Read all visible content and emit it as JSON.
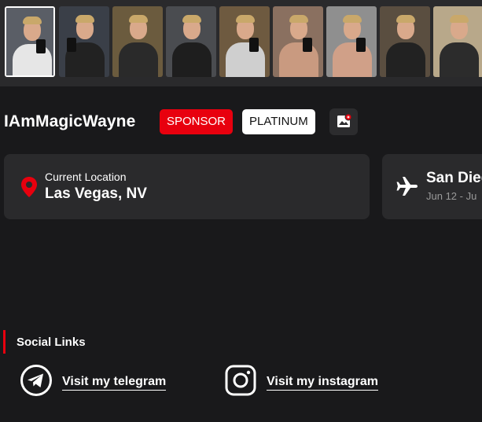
{
  "profile": {
    "name": "IAmMagicWayne",
    "badges": {
      "sponsor": "SPONSOR",
      "platinum": "PLATINUM"
    }
  },
  "photos": [
    {
      "name": "photo-1",
      "bg": "#5a5e66",
      "shirt": "#e6e6e6"
    },
    {
      "name": "photo-2",
      "bg": "#3a3f48",
      "shirt": "#222"
    },
    {
      "name": "photo-3",
      "bg": "#6b5b3e",
      "shirt": "#2a2a2a"
    },
    {
      "name": "photo-4",
      "bg": "#4a4c50",
      "shirt": "#1e1e1e"
    },
    {
      "name": "photo-5",
      "bg": "#6e5a40",
      "shirt": "#cfcfcf"
    },
    {
      "name": "photo-6",
      "bg": "#8a7060",
      "shirt": "#c99a80"
    },
    {
      "name": "photo-7",
      "bg": "#8f8f8f",
      "shirt": "#d0a088"
    },
    {
      "name": "photo-8",
      "bg": "#5a4e40",
      "shirt": "#222"
    },
    {
      "name": "photo-9",
      "bg": "#b8a88a",
      "shirt": "#2c2c2c"
    }
  ],
  "current_location": {
    "label": "Current Location",
    "value": "Las Vegas, NV",
    "icon": "map-pin-icon",
    "icon_color": "#e8000e"
  },
  "upcoming_trip": {
    "value": "San Dieg",
    "dates": "Jun 12 - Ju",
    "icon": "airplane-icon"
  },
  "social": {
    "title": "Social Links",
    "links": [
      {
        "label": "Visit my telegram",
        "icon": "telegram-icon"
      },
      {
        "label": "Visit my instagram",
        "icon": "instagram-icon"
      }
    ]
  },
  "colors": {
    "accent": "#e8000e",
    "background": "#19191b",
    "card": "#2a2a2c"
  }
}
